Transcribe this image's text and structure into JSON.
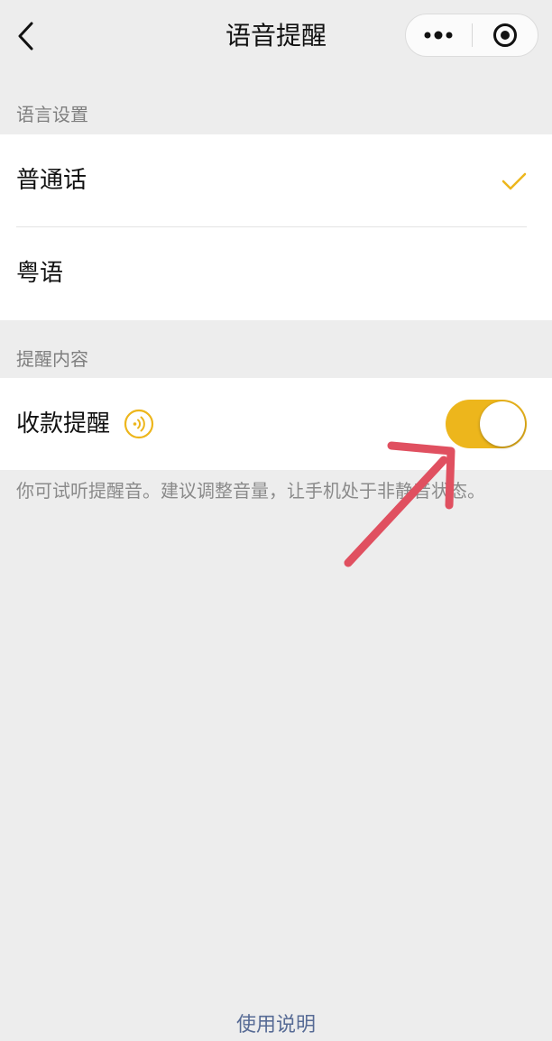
{
  "nav": {
    "title": "语音提醒",
    "back_icon": "chevron-left-icon",
    "more_icon": "more-dots-icon",
    "close_icon": "target-circle-icon"
  },
  "language_section": {
    "label": "语言设置",
    "options": [
      {
        "label": "普通话",
        "selected": true
      },
      {
        "label": "粤语",
        "selected": false
      }
    ]
  },
  "content_section": {
    "label": "提醒内容",
    "payment_reminder": {
      "label": "收款提醒",
      "sound_icon": "speaker-wave-icon",
      "enabled": true
    },
    "hint": "你可试听提醒音。建议调整音量，让手机处于非静音状态。"
  },
  "footer": {
    "help_link": "使用说明"
  },
  "colors": {
    "accent": "#edb61c",
    "background": "#ededed",
    "annotation_arrow": "#e05060",
    "link": "#576b95"
  }
}
